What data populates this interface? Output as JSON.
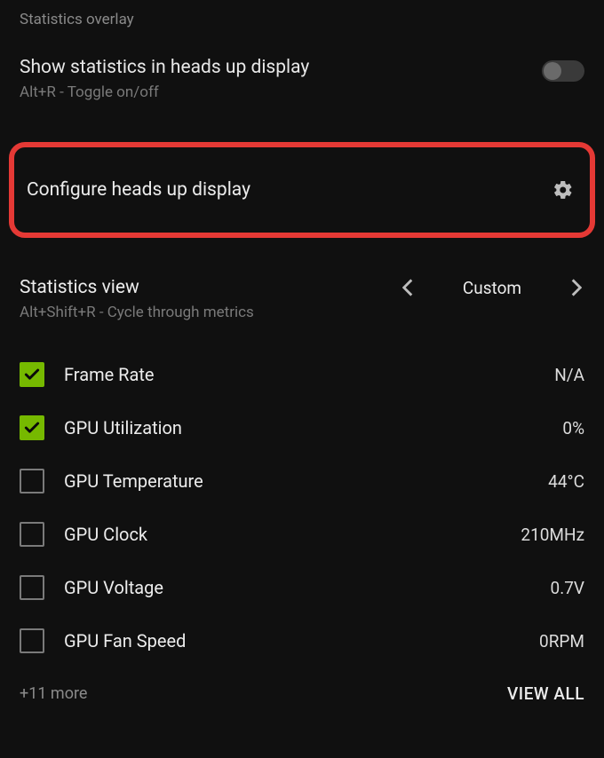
{
  "section_label": "Statistics overlay",
  "heads_up": {
    "title": "Show statistics in heads up display",
    "subtitle": "Alt+R - Toggle on/off",
    "enabled": false
  },
  "configure": {
    "title": "Configure heads up display"
  },
  "stats_view": {
    "title": "Statistics view",
    "subtitle": "Alt+Shift+R - Cycle through metrics",
    "value": "Custom"
  },
  "metrics": [
    {
      "label": "Frame Rate",
      "value": "N/A",
      "checked": true
    },
    {
      "label": "GPU Utilization",
      "value": "0%",
      "checked": true
    },
    {
      "label": "GPU Temperature",
      "value": "44°C",
      "checked": false
    },
    {
      "label": "GPU Clock",
      "value": "210MHz",
      "checked": false
    },
    {
      "label": "GPU Voltage",
      "value": "0.7V",
      "checked": false
    },
    {
      "label": "GPU Fan Speed",
      "value": "0RPM",
      "checked": false
    }
  ],
  "footer": {
    "more": "+11 more",
    "view_all": "VIEW ALL"
  }
}
